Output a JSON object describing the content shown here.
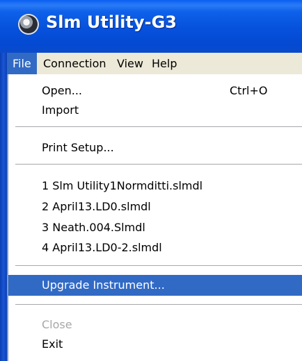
{
  "window": {
    "title": "Slm Utility-G3",
    "icon": "app-icon"
  },
  "menubar": {
    "items": [
      {
        "label": "File",
        "active": true
      },
      {
        "label": "Connection"
      },
      {
        "label": "View"
      },
      {
        "label": "Help"
      }
    ]
  },
  "file_menu": {
    "open": {
      "label": "Open...",
      "shortcut": "Ctrl+O"
    },
    "import": {
      "label": "Import"
    },
    "print_setup": {
      "label": "Print Setup..."
    },
    "recent": [
      {
        "label": "1 Slm Utility1Normditti.slmdl"
      },
      {
        "label": "2 April13.LD0.slmdl"
      },
      {
        "label": "3 Neath.004.Slmdl"
      },
      {
        "label": "4 April13.LD0-2.slmdl"
      }
    ],
    "upgrade": {
      "label": "Upgrade Instrument...",
      "highlighted": true
    },
    "close": {
      "label": "Close",
      "disabled": true
    },
    "exit": {
      "label": "Exit"
    }
  },
  "colors": {
    "titlebar": "#0651dc",
    "menu_highlight": "#316ac5",
    "menubar_bg": "#ece9d8",
    "disabled_text": "#a7a6aa"
  }
}
